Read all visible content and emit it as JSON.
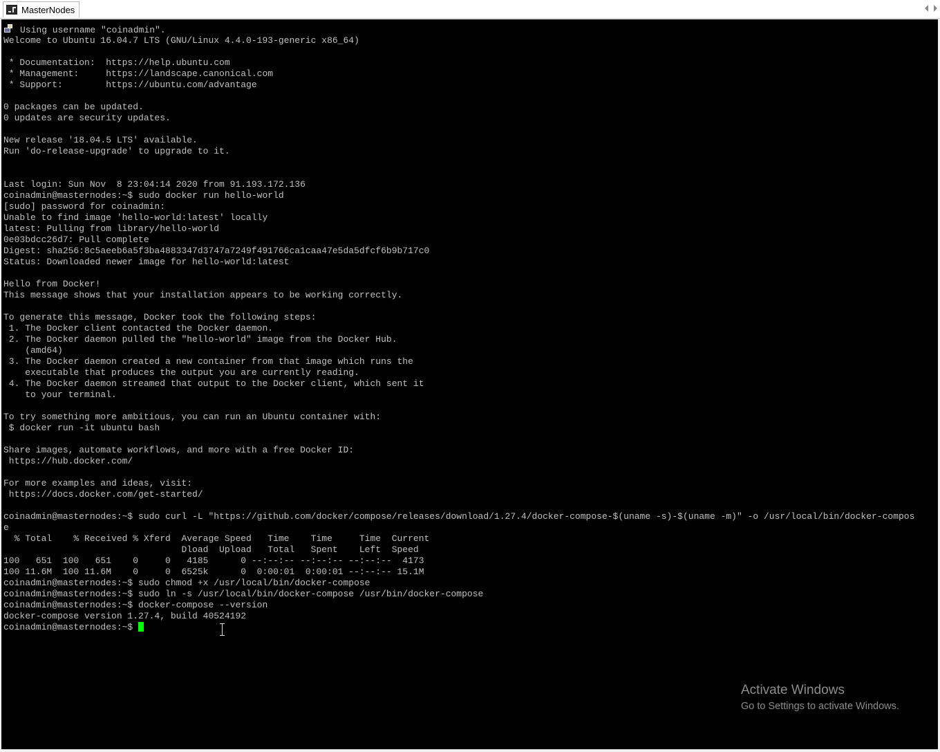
{
  "window": {
    "tab_title": "MasterNodes",
    "tab_icon": "putty-terminal-icon"
  },
  "terminal": {
    "colors": {
      "background": "#000000",
      "foreground": "#c0c0c0",
      "cursor": "#00ff00"
    },
    "first_line_icon": "putty-key-icon",
    "lines": [
      "Using username \"coinadmin\".",
      "Welcome to Ubuntu 16.04.7 LTS (GNU/Linux 4.4.0-193-generic x86_64)",
      "",
      " * Documentation:  https://help.ubuntu.com",
      " * Management:     https://landscape.canonical.com",
      " * Support:        https://ubuntu.com/advantage",
      "",
      "0 packages can be updated.",
      "0 updates are security updates.",
      "",
      "New release '18.04.5 LTS' available.",
      "Run 'do-release-upgrade' to upgrade to it.",
      "",
      "",
      "Last login: Sun Nov  8 23:04:14 2020 from 91.193.172.136",
      "coinadmin@masternodes:~$ sudo docker run hello-world",
      "[sudo] password for coinadmin:",
      "Unable to find image 'hello-world:latest' locally",
      "latest: Pulling from library/hello-world",
      "0e03bdcc26d7: Pull complete",
      "Digest: sha256:8c5aeeb6a5f3ba4883347d3747a7249f491766ca1caa47e5da5dfcf6b9b717c0",
      "Status: Downloaded newer image for hello-world:latest",
      "",
      "Hello from Docker!",
      "This message shows that your installation appears to be working correctly.",
      "",
      "To generate this message, Docker took the following steps:",
      " 1. The Docker client contacted the Docker daemon.",
      " 2. The Docker daemon pulled the \"hello-world\" image from the Docker Hub.",
      "    (amd64)",
      " 3. The Docker daemon created a new container from that image which runs the",
      "    executable that produces the output you are currently reading.",
      " 4. The Docker daemon streamed that output to the Docker client, which sent it",
      "    to your terminal.",
      "",
      "To try something more ambitious, you can run an Ubuntu container with:",
      " $ docker run -it ubuntu bash",
      "",
      "Share images, automate workflows, and more with a free Docker ID:",
      " https://hub.docker.com/",
      "",
      "For more examples and ideas, visit:",
      " https://docs.docker.com/get-started/",
      "",
      "coinadmin@masternodes:~$ sudo curl -L \"https://github.com/docker/compose/releases/download/1.27.4/docker-compose-$(uname -s)-$(uname -m)\" -o /usr/local/bin/docker-compos",
      "e",
      "  % Total    % Received % Xferd  Average Speed   Time    Time     Time  Current",
      "                                 Dload  Upload   Total   Spent    Left  Speed",
      "100   651  100   651    0     0   4185      0 --:--:-- --:--:-- --:--:--  4173",
      "100 11.6M  100 11.6M    0     0  6525k      0  0:00:01  0:00:01 --:--:-- 15.1M",
      "coinadmin@masternodes:~$ sudo chmod +x /usr/local/bin/docker-compose",
      "coinadmin@masternodes:~$ sudo ln -s /usr/local/bin/docker-compose /usr/bin/docker-compose",
      "coinadmin@masternodes:~$ docker-compose --version",
      "docker-compose version 1.27.4, build 40524192"
    ],
    "prompt": "coinadmin@masternodes:~$ "
  },
  "watermark": {
    "title": "Activate Windows",
    "subtitle": "Go to Settings to activate Windows."
  }
}
